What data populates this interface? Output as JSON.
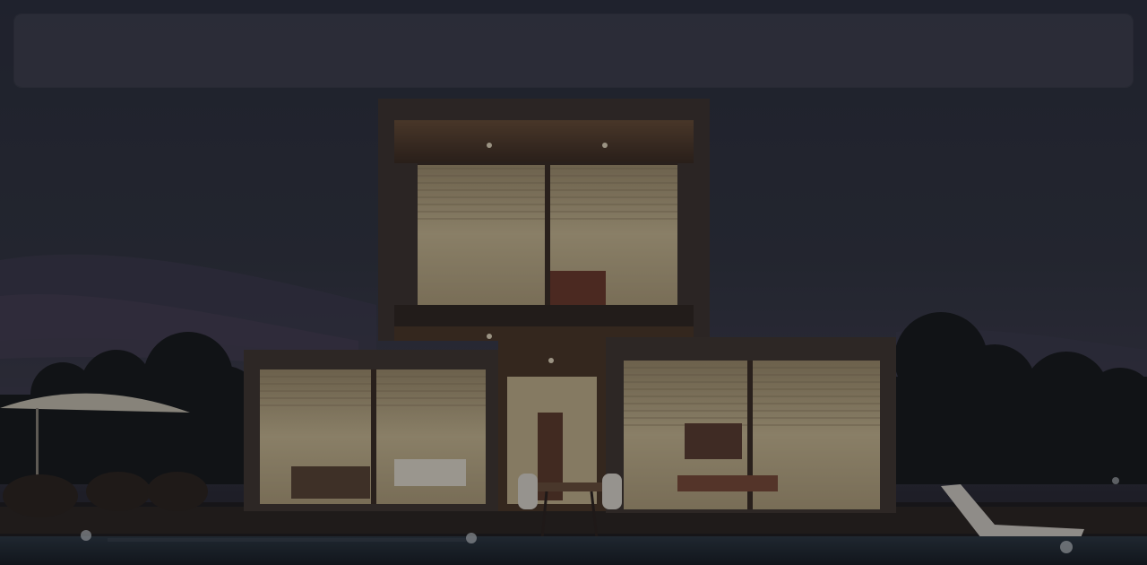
{
  "scene": {
    "description_icon": "modern-house-photo",
    "colors": {
      "sky_top": "#2d3140",
      "sky_bottom": "#3a3a4a",
      "warm_light": "#cbb98f",
      "wood": "#3b2a20",
      "frame": "#4a4138",
      "pool": "#1f2a33"
    }
  },
  "top_bar": {
    "background": "#2e2f3a"
  }
}
